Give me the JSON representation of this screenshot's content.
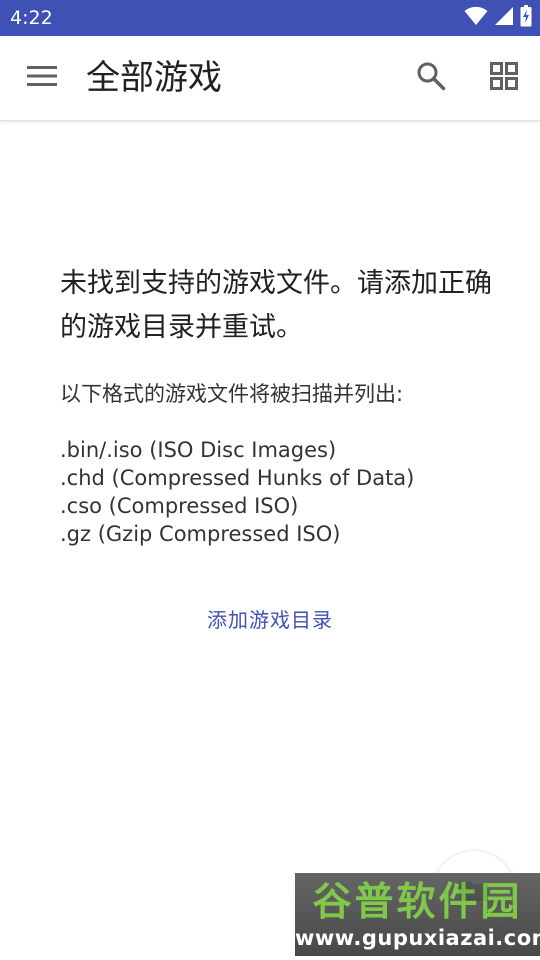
{
  "status_bar": {
    "time": "4:22",
    "icons": [
      "wifi-icon",
      "signal-icon",
      "battery-icon"
    ]
  },
  "app_bar": {
    "title": "全部游戏",
    "icons": [
      "menu-icon",
      "search-icon",
      "grid-view-icon"
    ]
  },
  "empty_state": {
    "title": "未找到支持的游戏文件。请添加正确的游戏目录并重试。",
    "intro": "以下格式的游戏文件将被扫描并列出:",
    "formats": [
      ".bin/.iso (ISO Disc Images)",
      ".chd (Compressed Hunks of Data)",
      ".cso (Compressed ISO)",
      ".gz (Gzip Compressed ISO)"
    ],
    "add_directory_label": "添加游戏目录"
  },
  "fab": {
    "icon": "folder-icon"
  },
  "watermark": {
    "name": "谷普软件园",
    "url": "www.gupuxiazai.com"
  },
  "colors": {
    "status_bar": "#3f51b5",
    "accent": "#3f51b5",
    "app_bar": "#ffffff",
    "watermark_green": "#76c43d"
  }
}
